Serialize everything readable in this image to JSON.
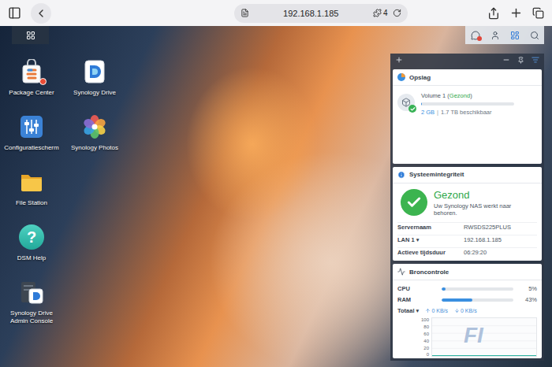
{
  "browser": {
    "url": "192.168.1.185",
    "tab_count": "4"
  },
  "desktop_icons": [
    {
      "label": "Package Center",
      "notification": true
    },
    {
      "label": "Configuratiescherm",
      "notification": false
    },
    {
      "label": "File Station",
      "notification": false
    },
    {
      "label": "DSM Help",
      "notification": false,
      "glyph": "?"
    },
    {
      "label": "Synology Drive Admin Console",
      "notification": false
    },
    {
      "label": "Synology Drive",
      "notification": false
    },
    {
      "label": "Synology Photos",
      "notification": false
    }
  ],
  "tray": {
    "messages_alert": true
  },
  "widgets": {
    "storage": {
      "title": "Opslag",
      "volume": "Volume 1 (",
      "status": "Gezond",
      "status_close": ")",
      "level": 0.002,
      "used": "2 GB",
      "separator": "|",
      "available": "1.7 TB beschikbaar"
    },
    "health": {
      "title": "Systeemintegriteit",
      "status": "Gezond",
      "message": "Uw Synology NAS werkt naar behoren.",
      "rows": [
        {
          "label": "Servernaam",
          "value": "RWSDS225PLUS"
        },
        {
          "label": "LAN 1 ▾",
          "value": "192.168.1.185"
        },
        {
          "label": "Actieve tijdsduur",
          "value": "06:29:20"
        }
      ]
    },
    "resources": {
      "title": "Broncontrole",
      "meters": [
        {
          "label": "CPU",
          "level": 0.05,
          "reading": "5%"
        },
        {
          "label": "RAM",
          "level": 0.43,
          "reading": "43%"
        }
      ],
      "network": {
        "label": "Totaal ▾",
        "upload": "0 KB/s",
        "download": "0 KB/s"
      },
      "chart": {
        "ticks": [
          "100",
          "80",
          "60",
          "40",
          "20",
          "0"
        ],
        "upload": [
          0,
          0,
          0,
          0,
          0,
          0,
          0,
          0,
          0,
          0,
          0,
          0
        ],
        "download": [
          0,
          0,
          0,
          0,
          0,
          0,
          0,
          0,
          0,
          0,
          0,
          0
        ],
        "watermark": "FI"
      }
    }
  }
}
